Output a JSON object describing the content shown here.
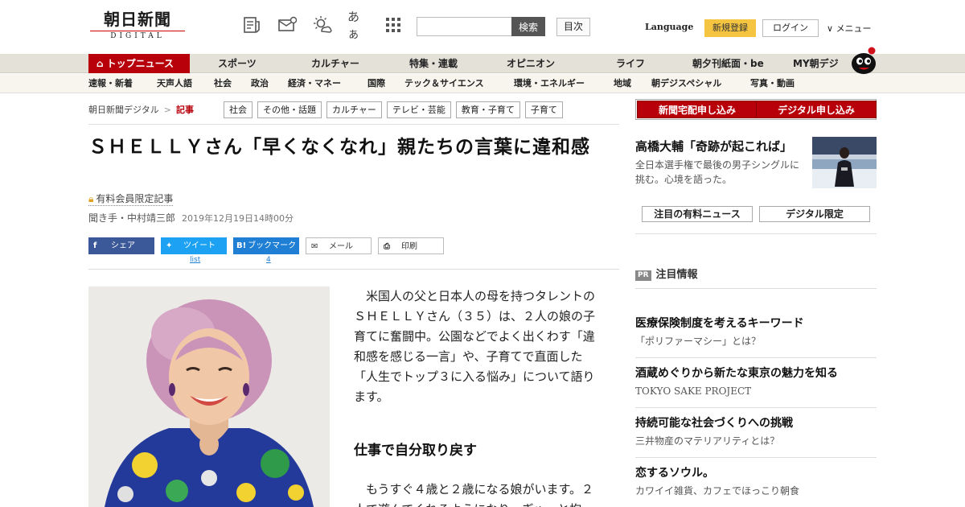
{
  "header": {
    "logo_main": "朝日新聞",
    "logo_sub": "DIGITAL",
    "icons": [
      "newspaper-icon",
      "mail-icon",
      "weather-icon",
      "font-size-icon",
      "grid-menu-icon"
    ],
    "font_icon_text": "あぁ",
    "search_placeholder": "",
    "search_button": "検索",
    "contents_button": "目次",
    "language": "Language",
    "register": "新規登録",
    "login": "ログイン",
    "menu": "メニュー"
  },
  "nav_primary": {
    "top": "トップニュース",
    "items": [
      "スポーツ",
      "カルチャー",
      "特集・連載",
      "オピニオン",
      "ライフ",
      "朝夕刊紙面・be",
      "MY朝デジ"
    ]
  },
  "nav_secondary": {
    "items": [
      "速報・新着",
      "天声人語",
      "社会",
      "政治",
      "経済・マネー",
      "国際",
      "テック＆サイエンス",
      "環境・エネルギー",
      "地域",
      "朝デジスペシャル",
      "写真・動画"
    ]
  },
  "breadcrumb": {
    "root": "朝日新聞デジタル",
    "sep": ">",
    "current": "記事"
  },
  "tags": [
    "社会",
    "その他・話題",
    "カルチャー",
    "テレビ・芸能",
    "教育・子育て",
    "子育て"
  ],
  "article": {
    "headline": "ＳＨＥＬＬＹさん「早くなくなれ」親たちの言葉に違和感",
    "paid_label": "有料会員限定記事",
    "author": "聞き手・中村靖三郎",
    "date": "2019年12月19日14時00分",
    "lead": "米国人の父と日本人の母を持つタレントのＳＨＥＬＬＹさん（３５）は、２人の娘の子育てに奮闘中。公園などでよく出くわす「違和感を感じる一言」や、子育てで直面した「人生でトップ３に入る悩み」について語ります。",
    "subhead": "仕事で自分取り戻す",
    "body": "もうすぐ４歳と２歳になる娘がいます。２人で遊んでくれるようになり、ぎゅっと抱"
  },
  "share": {
    "facebook": "シェア",
    "twitter": "ツイート",
    "twitter_count": "list",
    "hatena": "ブックマーク",
    "hatena_icon": "B!",
    "hatena_count": "4",
    "mail": "メール",
    "print": "印刷"
  },
  "sidebar": {
    "subscribe_home": "新聞宅配申し込み",
    "subscribe_digital": "デジタル申し込み",
    "feature_title": "高橋大輔「奇跡が起これば」",
    "feature_desc": "全日本選手権で最後の男子シングルに挑む。心境を語った。",
    "tab_paid": "注目の有料ニュース",
    "tab_digital": "デジタル限定",
    "pr_badge": "PR",
    "pr_title": "注目情報",
    "pr_items": [
      {
        "title": "医療保険制度を考えるキーワード",
        "desc": "「ポリファーマシー」とは？"
      },
      {
        "title": "酒蔵めぐりから新たな東京の魅力を知る",
        "desc": "TOKYO SAKE PROJECT"
      },
      {
        "title": "持続可能な社会づくりへの挑戦",
        "desc": "三井物産のマテリアリティとは？"
      },
      {
        "title": "恋するソウル。",
        "desc": "カワイイ雑貨、カフェでほっこり朝食"
      }
    ]
  },
  "colors": {
    "brand_red": "#b8000b",
    "register_yellow": "#f5c542",
    "facebook": "#3b5998",
    "twitter": "#1da1f2",
    "hatena": "#1e7fd4"
  }
}
